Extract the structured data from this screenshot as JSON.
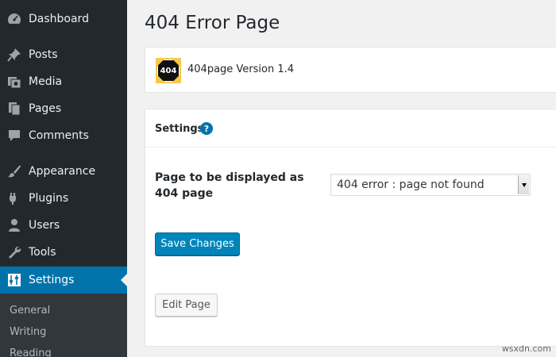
{
  "sidebar": {
    "items": [
      {
        "label": "Dashboard",
        "icon": "dashboard-icon"
      },
      {
        "label": "Posts",
        "icon": "pin-icon"
      },
      {
        "label": "Media",
        "icon": "media-icon"
      },
      {
        "label": "Pages",
        "icon": "pages-icon"
      },
      {
        "label": "Comments",
        "icon": "comment-icon"
      },
      {
        "label": "Appearance",
        "icon": "brush-icon"
      },
      {
        "label": "Plugins",
        "icon": "plug-icon"
      },
      {
        "label": "Users",
        "icon": "user-icon"
      },
      {
        "label": "Tools",
        "icon": "wrench-icon"
      },
      {
        "label": "Settings",
        "icon": "sliders-icon",
        "active": true
      }
    ],
    "submenu": [
      "General",
      "Writing",
      "Reading"
    ]
  },
  "page": {
    "title": "404 Error Page"
  },
  "plugin": {
    "logo_text": "404",
    "version_text": "404page Version 1.4"
  },
  "settings": {
    "heading": "Settings",
    "help_glyph": "?",
    "field_label": "Page to be displayed as 404 page",
    "select_value": "404 error : page not found",
    "save_label": "Save Changes",
    "edit_label": "Edit Page"
  },
  "watermark": "wsxdn.com",
  "colors": {
    "sidebar_bg": "#23282d",
    "active_bg": "#0073aa",
    "primary_button": "#0085ba"
  }
}
